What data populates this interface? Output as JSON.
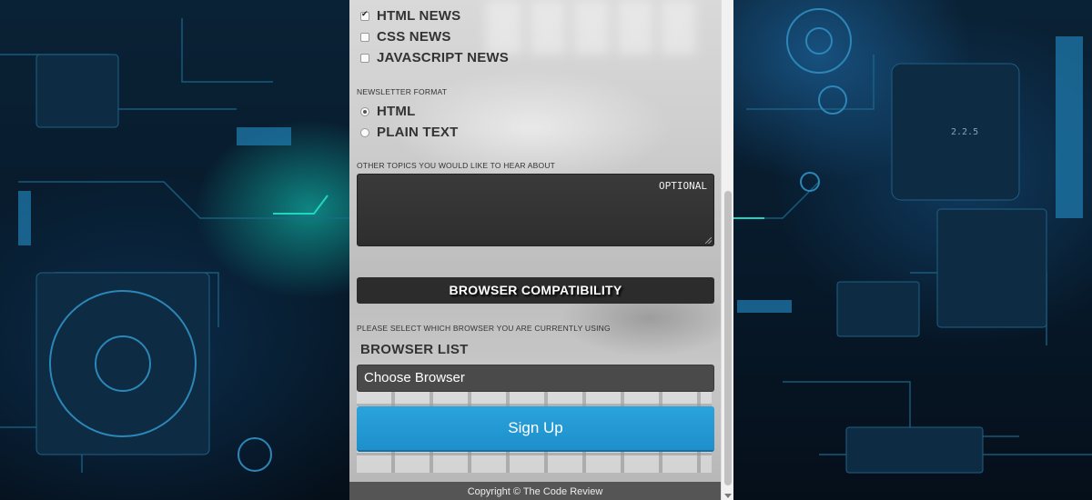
{
  "newsletter_topics": [
    {
      "label": "HTML NEWS",
      "checked": true
    },
    {
      "label": "CSS NEWS",
      "checked": false
    },
    {
      "label": "JAVASCRIPT NEWS",
      "checked": false
    }
  ],
  "format": {
    "label": "NEWSLETTER FORMAT",
    "options": [
      {
        "label": "HTML",
        "selected": true
      },
      {
        "label": "PLAIN TEXT",
        "selected": false
      }
    ]
  },
  "other_topics": {
    "label": "OTHER TOPICS YOU WOULD LIKE TO HEAR ABOUT",
    "placeholder": "OPTIONAL"
  },
  "compatibility": {
    "heading": "BROWSER COMPATIBILITY",
    "instruction": "PLEASE SELECT WHICH BROWSER YOU ARE CURRENTLY USING",
    "list_label": "BROWSER LIST",
    "select_value": "Choose Browser"
  },
  "signup_label": "Sign Up",
  "footer_text": "Copyright © The Code Review",
  "colors": {
    "accent": "#2aa3db",
    "dark_bar": "#2c2c2c",
    "select_bg": "#4a4a4a",
    "footer_bg": "#555555"
  }
}
